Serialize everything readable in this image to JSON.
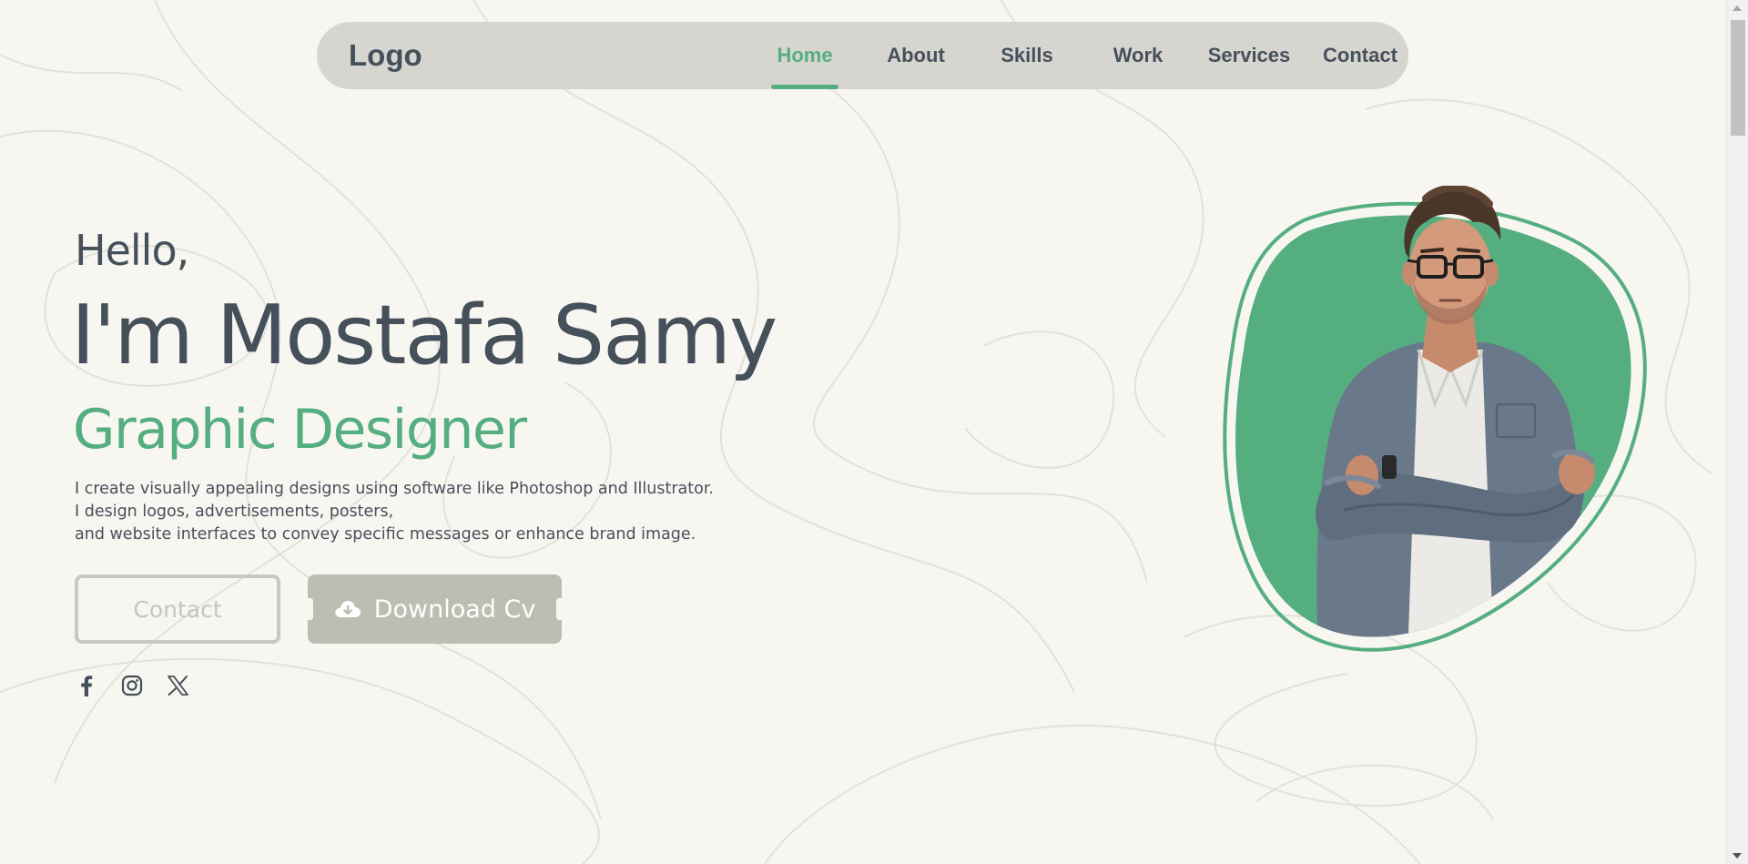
{
  "nav": {
    "logo": "Logo",
    "links": [
      {
        "label": "Home",
        "active": true
      },
      {
        "label": "About",
        "active": false
      },
      {
        "label": "Skills",
        "active": false
      },
      {
        "label": "Work",
        "active": false
      },
      {
        "label": "Services",
        "active": false
      },
      {
        "label": "Contact",
        "active": false
      }
    ]
  },
  "hero": {
    "greeting": "Hello,",
    "name": "I'm Mostafa Samy",
    "role": "Graphic Designer",
    "description": [
      "I create visually appealing designs using software like Photoshop and Illustrator.",
      "I design logos, advertisements, posters,",
      "and website interfaces to convey specific messages or enhance brand image."
    ],
    "contact_button": "Contact",
    "download_button": "Download Cv",
    "download_icon": "cloud-download-icon"
  },
  "socials": [
    {
      "icon": "facebook-icon"
    },
    {
      "icon": "instagram-icon"
    },
    {
      "icon": "x-twitter-icon"
    }
  ],
  "colors": {
    "accent": "#55ae80",
    "text": "#46505b",
    "background": "#f8f6f1",
    "navbar": "#d7d5d0",
    "button": "#bdbdb1"
  }
}
